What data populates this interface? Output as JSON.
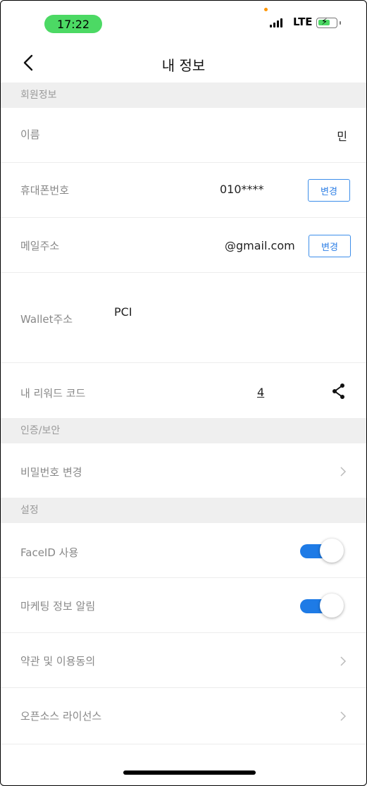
{
  "status_bar": {
    "time": "17:22",
    "network": "LTE"
  },
  "header": {
    "title": "내 정보"
  },
  "sections": {
    "member": "회원정보",
    "security": "인증/보안",
    "settings": "설정"
  },
  "member_info": {
    "name": {
      "label": "이름",
      "value": "민"
    },
    "phone": {
      "label": "휴대폰번호",
      "value": "010****",
      "button": "변경"
    },
    "email": {
      "label": "메일주소",
      "value": "@gmail.com",
      "button": "변경"
    },
    "wallet": {
      "label": "Wallet주소",
      "value": "PCI"
    },
    "reward": {
      "label": "내 리워드 코드",
      "value": "4"
    }
  },
  "security": {
    "change_password": "비밀번호 변경"
  },
  "settings": {
    "faceid": {
      "label": "FaceID 사용",
      "enabled": true
    },
    "marketing": {
      "label": "마케팅 정보 알림",
      "enabled": true
    },
    "terms": "약관 및 이용동의",
    "opensource": "오픈소스 라이선스"
  },
  "colors": {
    "accent": "#1e7be6",
    "time_pill": "#4cd964",
    "section_bg": "#efefef"
  }
}
